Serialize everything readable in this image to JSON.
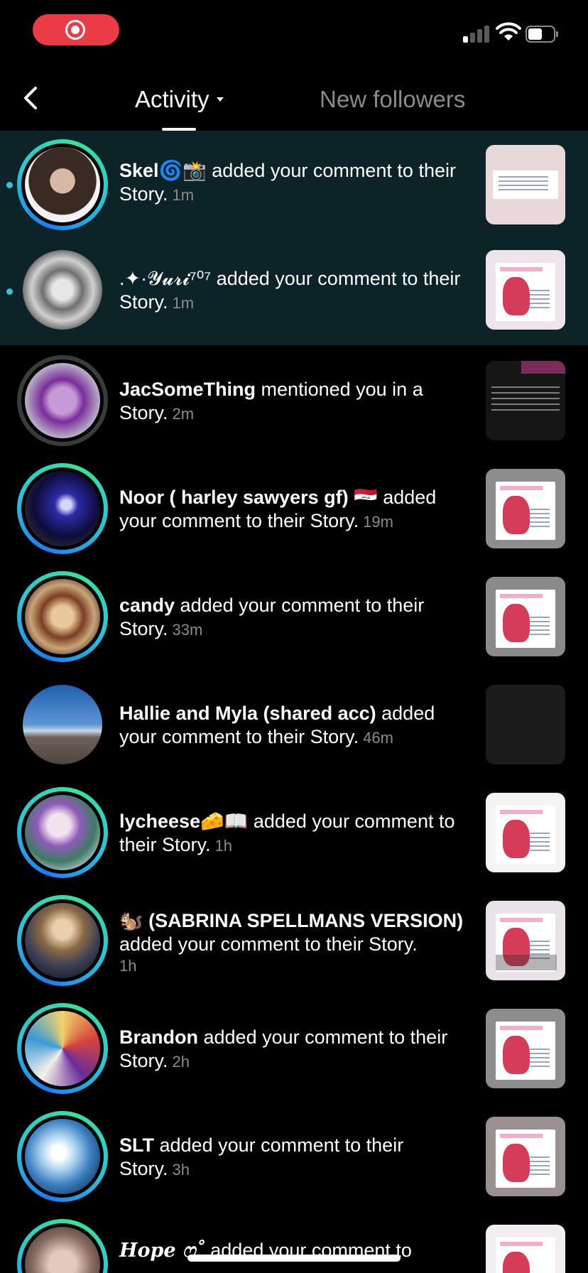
{
  "status_bar": {
    "signal_bars": 4,
    "signal_active": 1,
    "battery_level": 0.55
  },
  "header": {
    "back_icon": "chevron-left-icon",
    "tab_activity": "Activity",
    "tab_followers": "New followers",
    "caret_icon": "caret-down-icon"
  },
  "colors": {
    "unread_bg": "#0c2327",
    "unread_dot": "#35c1dd",
    "ring_gradient": [
      "#1b7ef4",
      "#27c8d8",
      "#35e39a"
    ],
    "muted_text": "#8b8b8b",
    "record_pill": "#ea3b46"
  },
  "activity": [
    {
      "name": "Skel🌀📸",
      "message": " added your comment to their Story.",
      "time": "1m",
      "unread": true
    },
    {
      "name": ".✦·𝓨𝓾𝓻𝓲⁷⁰⁷",
      "message": " added your comment to their Story.",
      "time": "1m",
      "unread": true
    },
    {
      "name": "JacSomeThing",
      "message": " mentioned you in a Story.",
      "time": "2m",
      "unread": false
    },
    {
      "name": "Noor ( harley sawyers gf) 🇮🇶",
      "message": " added your comment to their Story.",
      "time": "19m",
      "unread": false
    },
    {
      "name": "candy",
      "message": " added your comment to their Story.",
      "time": "33m",
      "unread": false
    },
    {
      "name": "Hallie and Myla (shared acc)",
      "message": " added your comment to their Story.",
      "time": "46m",
      "unread": false
    },
    {
      "name": "lycheese🧀📖",
      "message": " added your comment to their Story.",
      "time": "1h",
      "unread": false
    },
    {
      "name": "🐿️ (SABRINA SPELLMANS VERSION)",
      "message": " added your comment to their Story.",
      "time": "1h",
      "unread": false
    },
    {
      "name": "Brandon",
      "message": " added your comment to their Story.",
      "time": "2h",
      "unread": false
    },
    {
      "name": "SLT",
      "message": " added your comment to their Story.",
      "time": "3h",
      "unread": false
    },
    {
      "name": "Hope ෆ˚",
      "message": " added your comment to",
      "time": "",
      "unread": false
    }
  ]
}
